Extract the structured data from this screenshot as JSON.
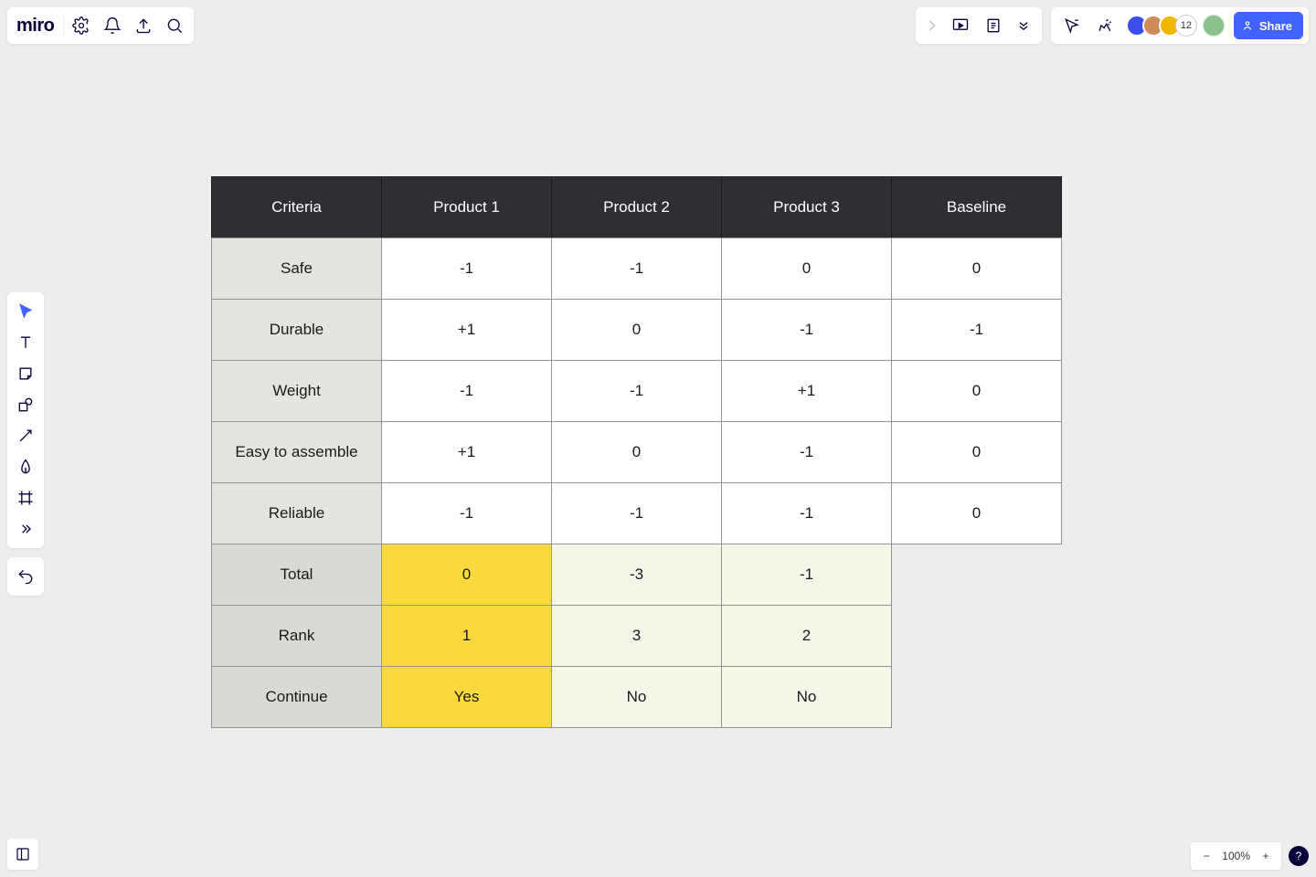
{
  "app": {
    "logo_text": "miro"
  },
  "topbar": {
    "share_label": "Share",
    "avatar_overflow_count": "12"
  },
  "zoom": {
    "level": "100%"
  },
  "help_label": "?",
  "table": {
    "headers": [
      "Criteria",
      "Product 1",
      "Product 2",
      "Product 3",
      "Baseline"
    ],
    "rows": [
      {
        "criteria": "Safe",
        "values": [
          "-1",
          "-1",
          "0",
          "0"
        ]
      },
      {
        "criteria": "Durable",
        "values": [
          "+1",
          "0",
          "-1",
          "-1"
        ]
      },
      {
        "criteria": "Weight",
        "values": [
          "-1",
          "-1",
          "+1",
          "0"
        ]
      },
      {
        "criteria": "Easy to assemble",
        "values": [
          "+1",
          "0",
          "-1",
          "0"
        ]
      },
      {
        "criteria": "Reliable",
        "values": [
          "-1",
          "-1",
          "-1",
          "0"
        ]
      }
    ],
    "summary": [
      {
        "label": "Total",
        "values": [
          "0",
          "-3",
          "-1"
        ],
        "highlight_index": 0
      },
      {
        "label": "Rank",
        "values": [
          "1",
          "3",
          "2"
        ],
        "highlight_index": 0
      },
      {
        "label": "Continue",
        "values": [
          "Yes",
          "No",
          "No"
        ],
        "highlight_index": 0
      }
    ]
  }
}
